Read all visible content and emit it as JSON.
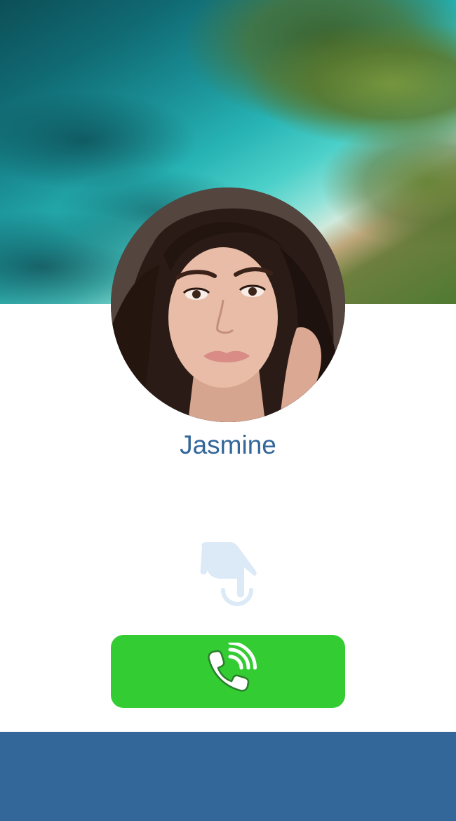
{
  "contact": {
    "name": "Jasmine"
  },
  "icons": {
    "tap_hint": "tap-hand-icon",
    "call": "phone-ringing-icon"
  },
  "colors": {
    "name_text": "#336699",
    "call_button": "#33cc33",
    "footer": "#336699",
    "tap_hint": "#dce9f7"
  }
}
